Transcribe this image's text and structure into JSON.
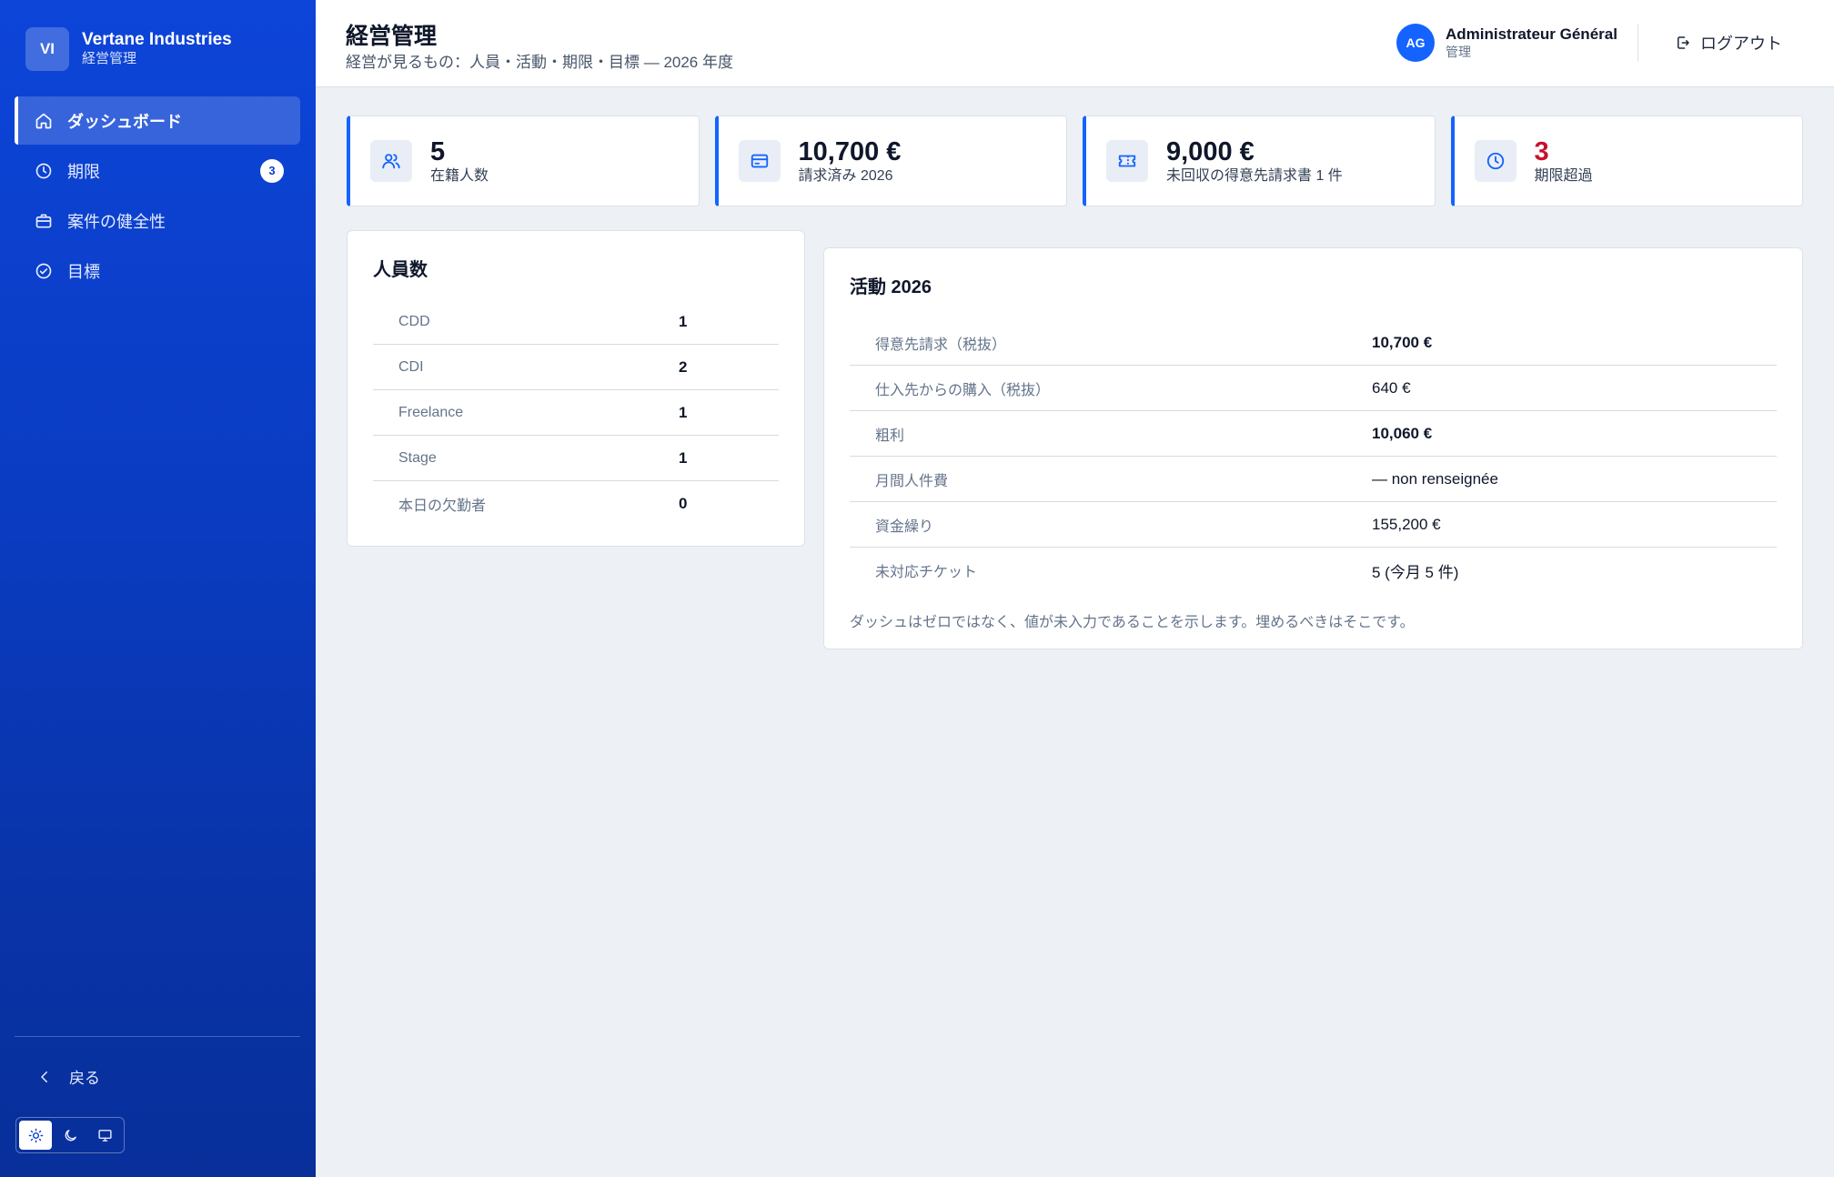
{
  "brand": {
    "initials": "VI",
    "name": "Vertane Industries",
    "subtitle": "経営管理"
  },
  "nav": {
    "items": [
      {
        "label": "ダッシュボード",
        "icon": "home-icon",
        "active": true
      },
      {
        "label": "期限",
        "icon": "clock-icon",
        "badge": "3"
      },
      {
        "label": "案件の健全性",
        "icon": "briefcase-icon"
      },
      {
        "label": "目標",
        "icon": "check-circle-icon"
      }
    ],
    "back_label": "戻る"
  },
  "header": {
    "title": "経営管理",
    "subtitle": "経営が見るもの：人員・活動・期限・目標 — 2026 年度",
    "user": {
      "initials": "AG",
      "name": "Administrateur Général",
      "role": "管理"
    },
    "logout_label": "ログアウト"
  },
  "stats": [
    {
      "value": "5",
      "label": "在籍人数",
      "icon": "users-icon"
    },
    {
      "value": "10,700 €",
      "label": "請求済み 2026",
      "icon": "invoice-icon"
    },
    {
      "value": "9,000 €",
      "label": "未回収の得意先請求書 1 件",
      "icon": "ticket-icon"
    },
    {
      "value": "3",
      "label": "期限超過",
      "icon": "clock-icon",
      "danger": true
    }
  ],
  "headcount": {
    "title": "人員数",
    "rows": [
      {
        "label": "CDD",
        "value": "1"
      },
      {
        "label": "CDI",
        "value": "2"
      },
      {
        "label": "Freelance",
        "value": "1"
      },
      {
        "label": "Stage",
        "value": "1"
      },
      {
        "label": "本日の欠勤者",
        "value": "0"
      }
    ]
  },
  "activity": {
    "title": "活動 2026",
    "rows": [
      {
        "label": "得意先請求（税抜）",
        "value": "10,700 €",
        "bold": true
      },
      {
        "label": "仕入先からの購入（税抜）",
        "value": "640 €"
      },
      {
        "label": "粗利",
        "value": "10,060 €",
        "bold": true
      },
      {
        "label": "月間人件費",
        "value": "— non renseignée"
      },
      {
        "label": "資金繰り",
        "value": "155,200 €"
      },
      {
        "label": "未対応チケット",
        "value": "5 (今月 5 件)"
      }
    ],
    "note": "ダッシュはゼロではなく、値が未入力であることを示します。埋めるべきはそこです。"
  },
  "colors": {
    "primary": "#1463ff",
    "sidebar": "#0b3fd0",
    "danger": "#c8102e"
  }
}
